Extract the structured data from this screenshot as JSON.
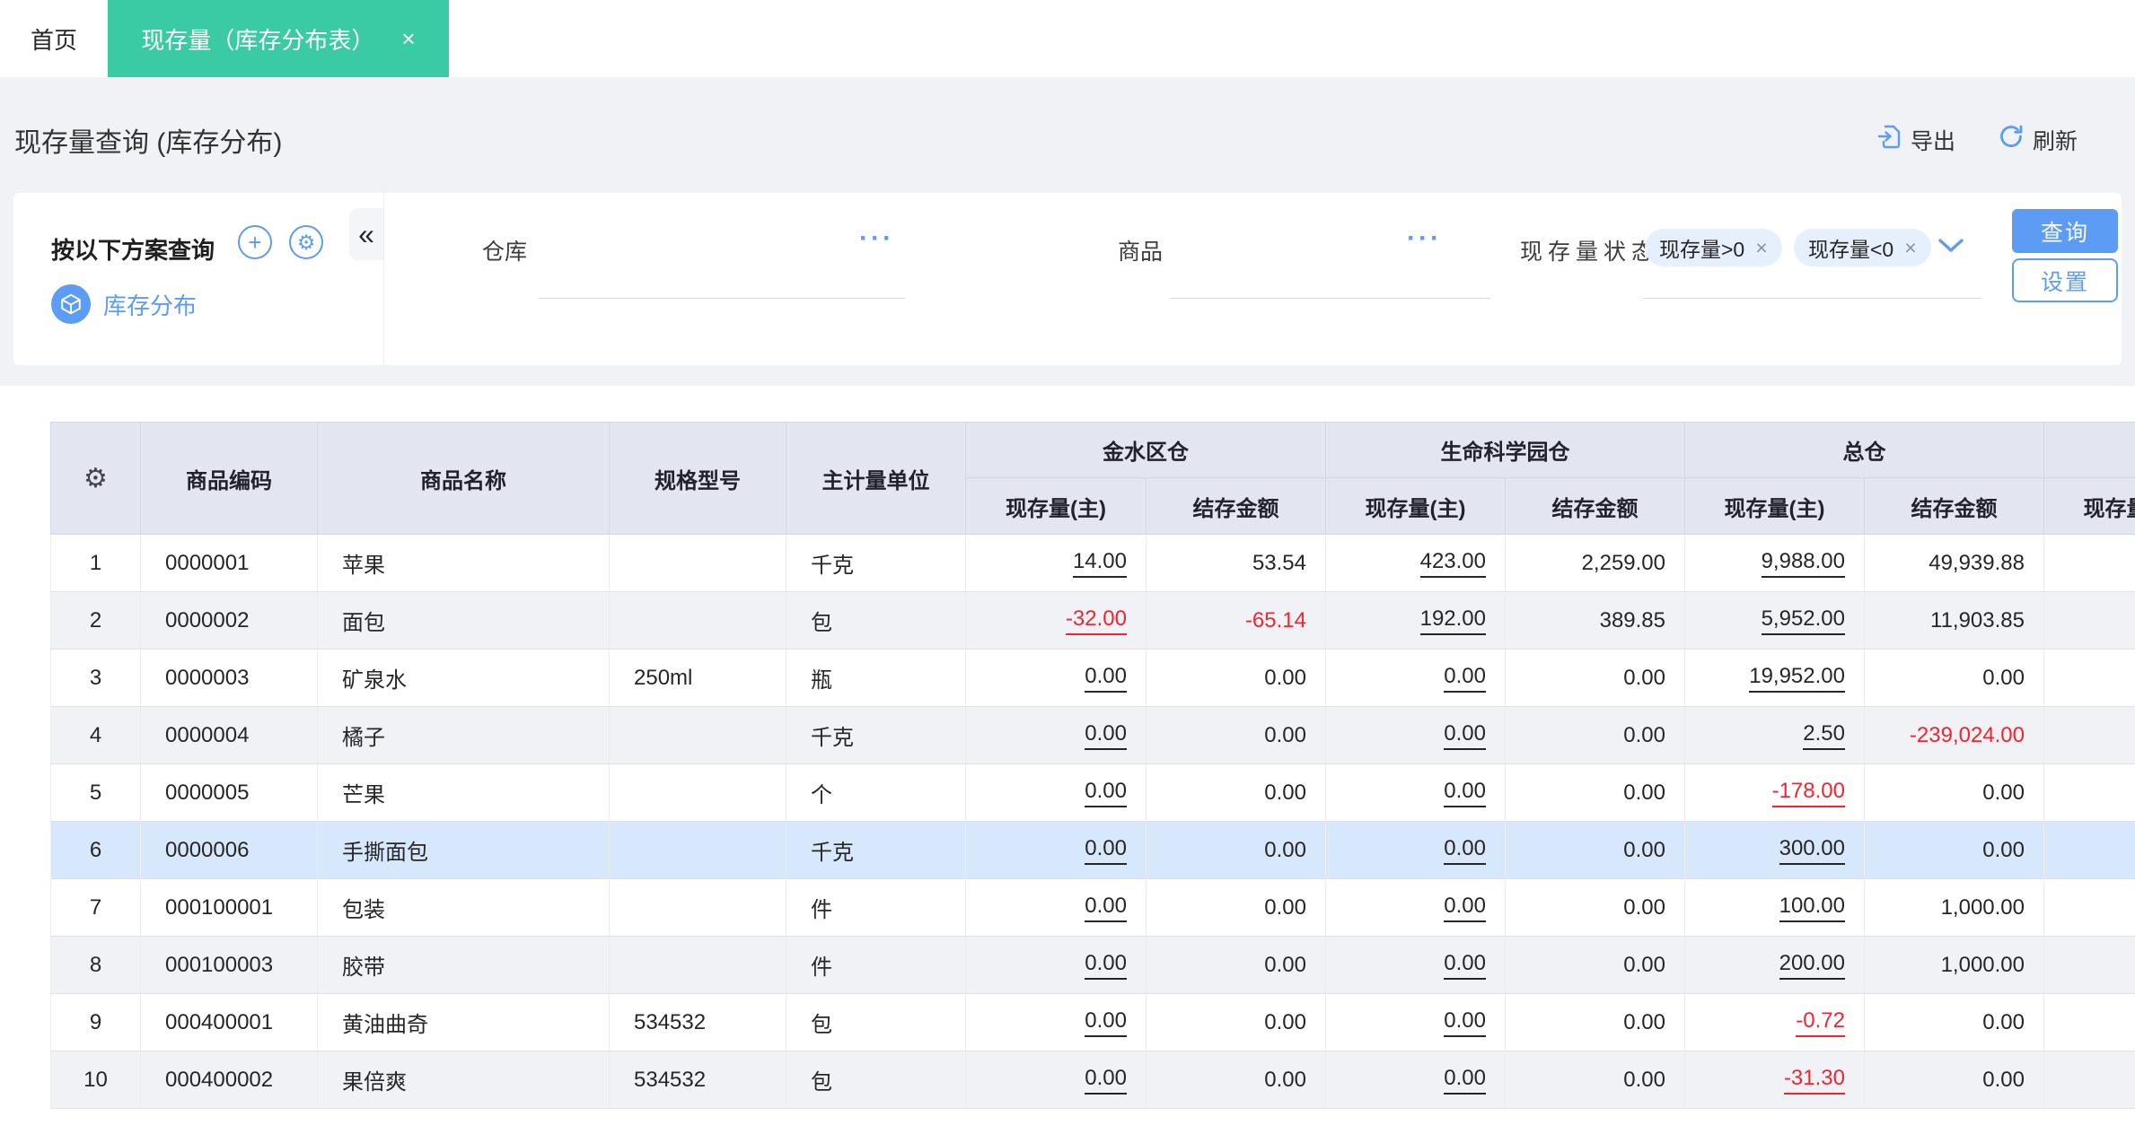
{
  "colors": {
    "accent_green": "#3BCBA3",
    "accent_blue": "#5D9CF4",
    "negative_red": "#F5232E",
    "header_bg": "#E3E6F1",
    "selected_row_bg": "#D8E8FC",
    "striped_row_bg": "#F1F2F6"
  },
  "icons": {
    "close": "×",
    "plus": "+",
    "gear": "⚙",
    "collapse": "«",
    "more": "···",
    "tag_close": "×"
  },
  "tabs": {
    "home": "首页",
    "active": "现存量（库存分布表）"
  },
  "page": {
    "title": "现存量查询 (库存分布)",
    "export_label": "导出",
    "refresh_label": "刷新"
  },
  "filter": {
    "scheme_title": "按以下方案查询",
    "scheme_name": "库存分布",
    "warehouse_label": "仓库",
    "warehouse_value": "",
    "product_label": "商品",
    "product_value": "",
    "status_label": "现存量状态",
    "status_tags": [
      "现存量>0",
      "现存量<0"
    ],
    "query_label": "查询",
    "settings_label": "设置"
  },
  "table": {
    "row_headers": [
      "商品编码",
      "商品名称",
      "规格型号",
      "主计量单位"
    ],
    "groups": [
      {
        "name": "金水区仓",
        "subs": [
          "现存量(主)",
          "结存金额"
        ]
      },
      {
        "name": "生命科学园仓",
        "subs": [
          "现存量(主)",
          "结存金额"
        ]
      },
      {
        "name": "总仓",
        "subs": [
          "现存量(主)",
          "结存金额"
        ]
      }
    ],
    "partial_sub_header": "现存量(主)",
    "rows": [
      {
        "num": "1",
        "code": "0000001",
        "name": "苹果",
        "spec": "",
        "unit": "千克",
        "selected": false,
        "values": [
          "14.00",
          "53.54",
          "423.00",
          "2,259.00",
          "9,988.00",
          "49,939.88"
        ]
      },
      {
        "num": "2",
        "code": "0000002",
        "name": "面包",
        "spec": "",
        "unit": "包",
        "selected": false,
        "values": [
          "-32.00",
          "-65.14",
          "192.00",
          "389.85",
          "5,952.00",
          "11,903.85"
        ]
      },
      {
        "num": "3",
        "code": "0000003",
        "name": "矿泉水",
        "spec": "250ml",
        "unit": "瓶",
        "selected": false,
        "values": [
          "0.00",
          "0.00",
          "0.00",
          "0.00",
          "19,952.00",
          "0.00"
        ]
      },
      {
        "num": "4",
        "code": "0000004",
        "name": "橘子",
        "spec": "",
        "unit": "千克",
        "selected": false,
        "values": [
          "0.00",
          "0.00",
          "0.00",
          "0.00",
          "2.50",
          "-239,024.00"
        ]
      },
      {
        "num": "5",
        "code": "0000005",
        "name": "芒果",
        "spec": "",
        "unit": "个",
        "selected": false,
        "values": [
          "0.00",
          "0.00",
          "0.00",
          "0.00",
          "-178.00",
          "0.00"
        ]
      },
      {
        "num": "6",
        "code": "0000006",
        "name": "手撕面包",
        "spec": "",
        "unit": "千克",
        "selected": true,
        "values": [
          "0.00",
          "0.00",
          "0.00",
          "0.00",
          "300.00",
          "0.00"
        ]
      },
      {
        "num": "7",
        "code": "000100001",
        "name": "包装",
        "spec": "",
        "unit": "件",
        "selected": false,
        "values": [
          "0.00",
          "0.00",
          "0.00",
          "0.00",
          "100.00",
          "1,000.00"
        ]
      },
      {
        "num": "8",
        "code": "000100003",
        "name": "胶带",
        "spec": "",
        "unit": "件",
        "selected": false,
        "values": [
          "0.00",
          "0.00",
          "0.00",
          "0.00",
          "200.00",
          "1,000.00"
        ]
      },
      {
        "num": "9",
        "code": "000400001",
        "name": "黄油曲奇",
        "spec": "534532",
        "unit": "包",
        "selected": false,
        "values": [
          "0.00",
          "0.00",
          "0.00",
          "0.00",
          "-0.72",
          "0.00"
        ]
      },
      {
        "num": "10",
        "code": "000400002",
        "name": "果倍爽",
        "spec": "534532",
        "unit": "包",
        "selected": false,
        "values": [
          "0.00",
          "0.00",
          "0.00",
          "0.00",
          "-31.30",
          "0.00"
        ]
      }
    ]
  }
}
